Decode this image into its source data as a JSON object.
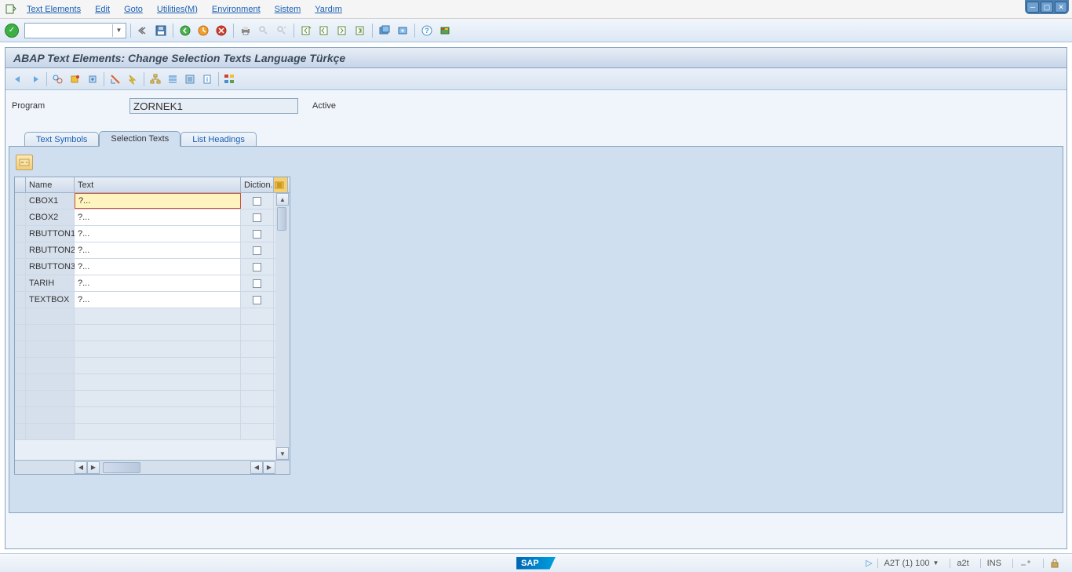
{
  "menu": {
    "items": [
      "Text Elements",
      "Edit",
      "Goto",
      "Utilities(M)",
      "Environment",
      "Sistem",
      "Yardım"
    ]
  },
  "title": "ABAP Text Elements: Change Selection Texts Language Türkçe",
  "form": {
    "program_label": "Program",
    "program_value": "ZORNEK1",
    "status": "Active"
  },
  "tabs": {
    "items": [
      "Text Symbols",
      "Selection Texts",
      "List Headings"
    ],
    "active_index": 1
  },
  "grid": {
    "columns": {
      "name": "Name",
      "text": "Text",
      "dict": "Diction."
    },
    "rows": [
      {
        "name": "CBOX1",
        "text": "?...",
        "dict": false,
        "selected": true
      },
      {
        "name": "CBOX2",
        "text": "?...",
        "dict": false
      },
      {
        "name": "RBUTTON1",
        "text": "?...",
        "dict": false
      },
      {
        "name": "RBUTTON2",
        "text": "?...",
        "dict": false
      },
      {
        "name": "RBUTTON3",
        "text": "?...",
        "dict": false
      },
      {
        "name": "TARIH",
        "text": "?...",
        "dict": false
      },
      {
        "name": "TEXTBOX",
        "text": "?...",
        "dict": false
      }
    ],
    "empty_rows": 8
  },
  "status": {
    "system": "A2T (1) 100",
    "server": "a2t",
    "mode": "INS"
  }
}
